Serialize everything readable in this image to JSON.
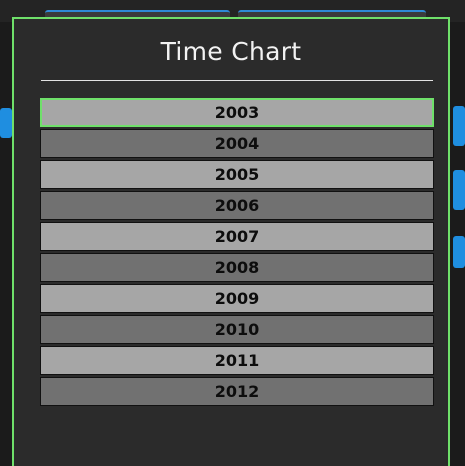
{
  "dialog": {
    "title": "Time Chart"
  },
  "years": [
    {
      "label": "2003",
      "selected": true
    },
    {
      "label": "2004",
      "selected": false
    },
    {
      "label": "2005",
      "selected": false
    },
    {
      "label": "2006",
      "selected": false
    },
    {
      "label": "2007",
      "selected": false
    },
    {
      "label": "2008",
      "selected": false
    },
    {
      "label": "2009",
      "selected": false
    },
    {
      "label": "2010",
      "selected": false
    },
    {
      "label": "2011",
      "selected": false
    },
    {
      "label": "2012",
      "selected": false
    }
  ],
  "colors": {
    "accent_border": "#6fe06a",
    "row_light": "#a6a6a6",
    "row_dark": "#717171",
    "dialog_bg": "#2b2b2b",
    "background_blue": "#1f8ee0"
  }
}
